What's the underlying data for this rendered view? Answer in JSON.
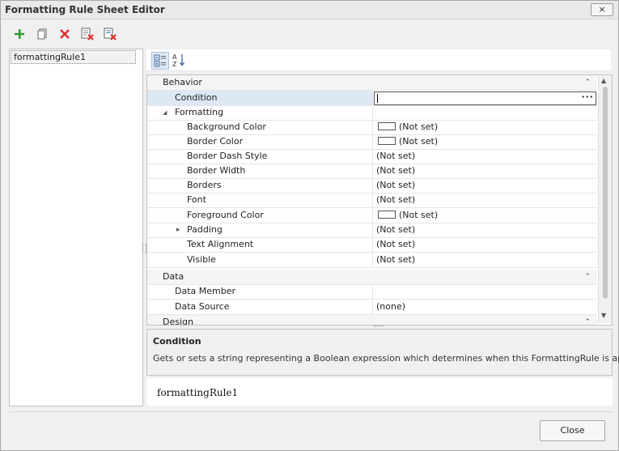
{
  "window": {
    "title": "Formatting Rule Sheet Editor",
    "close_glyph": "×"
  },
  "toolbar": {
    "buttons": [
      {
        "icon": "add-icon"
      },
      {
        "icon": "copy-icon"
      },
      {
        "icon": "delete-icon"
      },
      {
        "icon": "delete-list-icon"
      },
      {
        "icon": "purge-icon"
      }
    ]
  },
  "rules_list": {
    "items": [
      "formattingRule1"
    ]
  },
  "property_grid": {
    "toolbar": {
      "categorized_icon": "categorized-icon",
      "alphabetical_icon": "sort-az-icon",
      "alphabetical_label": "A Z"
    },
    "categories": {
      "behavior": "Behavior",
      "data": "Data",
      "design": "Design"
    },
    "rows": {
      "condition": {
        "name": "Condition",
        "value": ""
      },
      "formatting": {
        "name": "Formatting"
      },
      "background_color": {
        "name": "Background Color",
        "value": "(Not set)"
      },
      "border_color": {
        "name": "Border Color",
        "value": "(Not set)"
      },
      "border_dash_style": {
        "name": "Border Dash Style",
        "value": "(Not set)"
      },
      "border_width": {
        "name": "Border Width",
        "value": "(Not set)"
      },
      "borders": {
        "name": "Borders",
        "value": "(Not set)"
      },
      "font": {
        "name": "Font",
        "value": "(Not set)"
      },
      "foreground_color": {
        "name": "Foreground Color",
        "value": "(Not set)"
      },
      "padding": {
        "name": "Padding",
        "value": "(Not set)"
      },
      "text_alignment": {
        "name": "Text Alignment",
        "value": "(Not set)"
      },
      "visible": {
        "name": "Visible",
        "value": "(Not set)"
      },
      "data_member": {
        "name": "Data Member",
        "value": ""
      },
      "data_source": {
        "name": "Data Source",
        "value": "(none)"
      }
    },
    "editor_button": "···",
    "expanded_glyph": "◢",
    "collapsed_glyph": "▸",
    "category_caret": "⌃"
  },
  "description": {
    "title": "Condition",
    "text": "Gets or sets a string representing a Boolean expression which determines when this FormattingRule is applied."
  },
  "preview": {
    "text": "formattingRule1"
  },
  "footer": {
    "close_label": "Close"
  },
  "colors": {
    "accent_blue": "#dde8f4",
    "add_green": "#2e9e2e",
    "delete_red": "#e02b2b"
  }
}
